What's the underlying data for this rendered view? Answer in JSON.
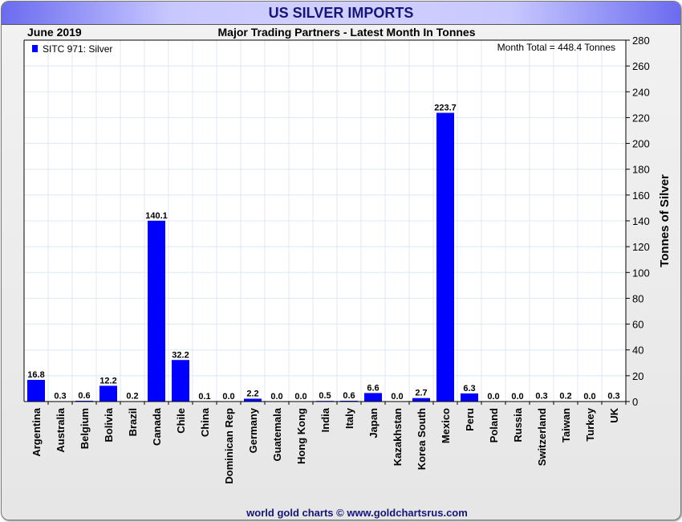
{
  "header": {
    "title": "US SILVER IMPORTS"
  },
  "footer": {
    "credit": "world gold charts © www.goldchartsrus.com"
  },
  "colors": {
    "bar": "#0000ff",
    "title": "#15157a",
    "grid": "#dde8f3"
  },
  "chart_data": {
    "type": "bar",
    "title": "Major Trading Partners - Latest Month In Tonnes",
    "period": "June 2019",
    "annotation": "Month Total = 448.4 Tonnes",
    "legend": {
      "label": "SITC 971: Silver",
      "placement": "top-left"
    },
    "ylabel": "Tonnes of Silver",
    "xlabel": "",
    "ylim": [
      0,
      280
    ],
    "yticks": [
      0,
      20,
      40,
      60,
      80,
      100,
      120,
      140,
      160,
      180,
      200,
      220,
      240,
      260,
      280
    ],
    "grid": true,
    "categories": [
      "Argentina",
      "Australia",
      "Belgium",
      "Bolivia",
      "Brazil",
      "Canada",
      "Chile",
      "China",
      "Dominican Rep",
      "Germany",
      "Guatemala",
      "Hong Kong",
      "India",
      "Italy",
      "Japan",
      "Kazakhstan",
      "Korea South",
      "Mexico",
      "Peru",
      "Poland",
      "Russia",
      "Switzerland",
      "Taiwan",
      "Turkey",
      "UK"
    ],
    "values": [
      16.8,
      0.3,
      0.6,
      12.2,
      0.2,
      140.1,
      32.2,
      0.1,
      0.0,
      2.2,
      0.0,
      0.0,
      0.5,
      0.6,
      6.6,
      0.0,
      2.7,
      223.7,
      6.3,
      0.0,
      0.0,
      0.3,
      0.2,
      0.0,
      0.3
    ]
  }
}
